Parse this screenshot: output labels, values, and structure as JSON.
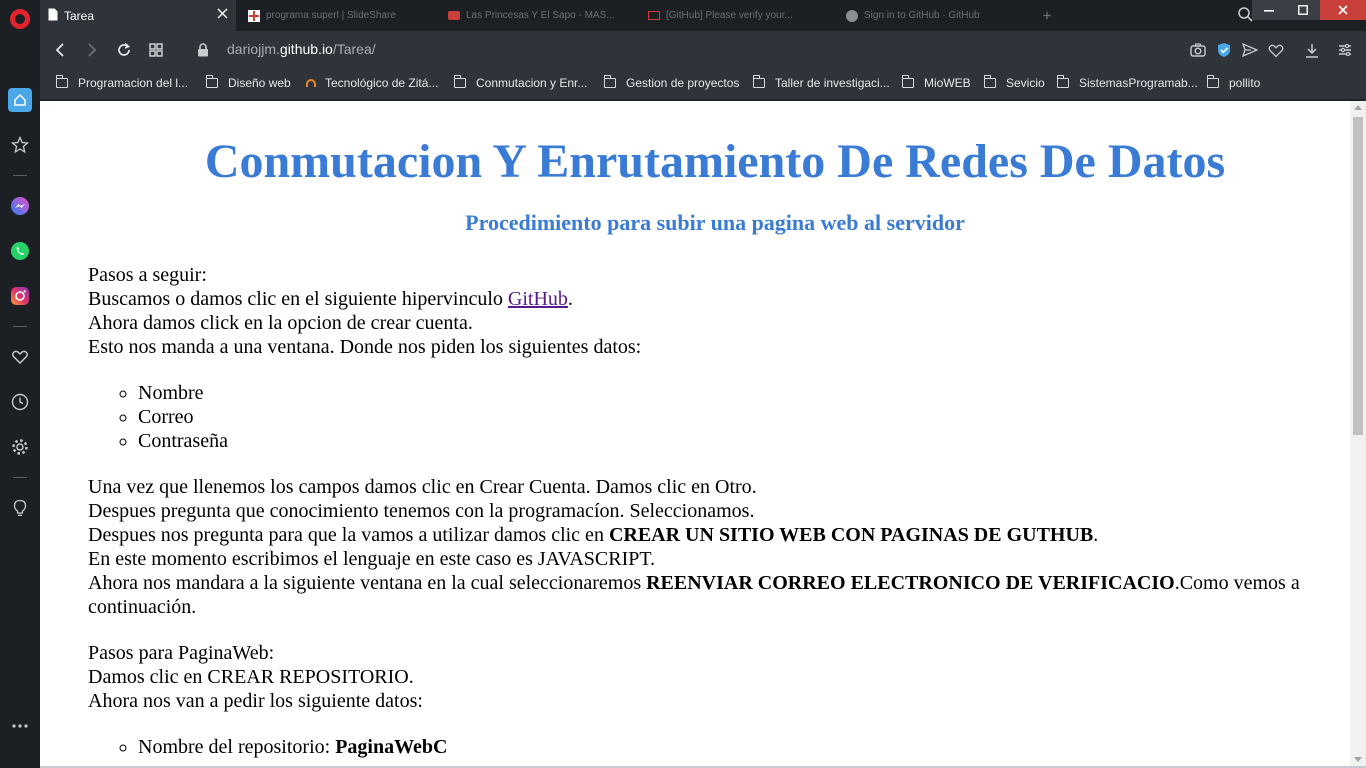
{
  "browser": {
    "tabs": [
      {
        "title": "Tarea",
        "active": true
      },
      {
        "title": "programa superl | SlideShare",
        "active": false
      },
      {
        "title": "Las Princesas Y El Sapo - MAS...",
        "active": false
      },
      {
        "title": "[GitHub] Please verify your...",
        "active": false
      },
      {
        "title": "Sign in to GitHub · GitHub",
        "active": false
      }
    ],
    "url": {
      "prefix": "dariojjm.",
      "domain": "github.io",
      "path": "/Tarea/"
    },
    "bookmarks": [
      "Programacion del l...",
      "Diseño web",
      "Tecnológico de Zitá...",
      "Conmutacion y Enr...",
      "Gestion de proyectos",
      "Taller de investigaci...",
      "MioWEB",
      "Sevicio",
      "SistemasProgramab...",
      "pollito"
    ]
  },
  "page": {
    "title": "Conmutacion Y Enrutamiento De Redes De Datos",
    "subtitle": "Procedimiento para subir una pagina web al servidor",
    "section1": {
      "line1": "Pasos a seguir:",
      "line2_before": "Buscamos o damos clic en el siguiente hipervinculo ",
      "link": "GitHub",
      "line2_after": ".",
      "line3": "Ahora damos click en la opcion de crear cuenta.",
      "line4": "Esto nos manda a una ventana. Donde nos piden los siguientes datos:"
    },
    "fields": [
      "Nombre",
      "Correo",
      "Contraseña"
    ],
    "section2": {
      "line1": "Una vez que llenemos los campos damos clic en Crear Cuenta. Damos clic en Otro.",
      "line2": "Despues pregunta que conocimiento tenemos con la programacíon. Seleccionamos.",
      "line3_before": "Despues nos pregunta para que la vamos a utilizar damos clic en ",
      "line3_bold": "CREAR UN SITIO WEB CON PAGINAS DE GUTHUB",
      "line3_after": ".",
      "line4": "En este momento escribimos el lenguaje en este caso es JAVASCRIPT.",
      "line5_before": "Ahora nos mandara a la siguiente ventana en la cual seleccionaremos ",
      "line5_bold": "REENVIAR CORREO ELECTRONICO DE VERIFICACIO",
      "line5_after": ".Como vemos a continuación."
    },
    "section3": {
      "line1": "Pasos para PaginaWeb:",
      "line2": "Damos clic en CREAR REPOSITORIO.",
      "line3": "Ahora nos van a pedir los siguiente datos:"
    },
    "repo_item": {
      "label": "Nombre del repositorio: ",
      "value": "PaginaWebC"
    }
  },
  "colors": {
    "heading": "#3a7bd5",
    "link_visited": "#551a8b",
    "opera_red": "#e0242a"
  }
}
